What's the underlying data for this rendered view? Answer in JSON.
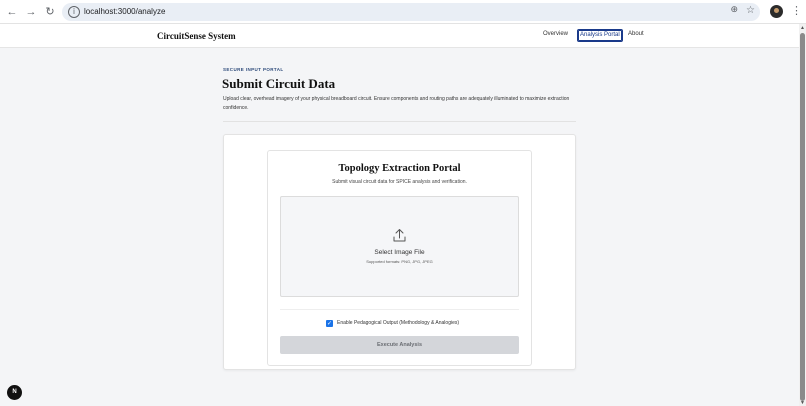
{
  "browser": {
    "url": "localhost:3000/analyze",
    "back_icon": "←",
    "forward_icon": "→",
    "reload_icon": "↻",
    "info_icon": "i",
    "zoom_icon": "⊕",
    "star_icon": "☆",
    "menu_icon": "⋮"
  },
  "header": {
    "brand": "CircuitSense System",
    "nav": [
      {
        "label": "Overview"
      },
      {
        "label": "Analysis Portal",
        "active": true
      },
      {
        "label": "About"
      }
    ]
  },
  "page": {
    "eyebrow": "SECURE INPUT PORTAL",
    "title": "Submit Circuit Data",
    "description": "Upload clear, overhead imagery of your physical breadboard circuit. Ensure components and routing paths are adequately illuminated to maximize extraction confidence."
  },
  "portal": {
    "title": "Topology Extraction Portal",
    "subtitle": "Submit visual circuit data for SPICE analysis and verification.",
    "dropzone": {
      "label": "Select Image File",
      "formats": "Supported formats: PNG, JPG, JPEG"
    },
    "pedagogical": {
      "label": "Enable Pedagogical Output (Methodology & Analogies)",
      "checked": true,
      "check_glyph": "✓"
    },
    "execute_label": "Execute Analysis"
  },
  "fab": {
    "label": "N"
  },
  "scrollbar": {
    "up": "▲",
    "down": "▼"
  },
  "colors": {
    "accent": "#1a73e8",
    "nav_active": "#1a3a8a",
    "button_disabled_bg": "#d4d6da",
    "background": "#f4f5f7"
  }
}
